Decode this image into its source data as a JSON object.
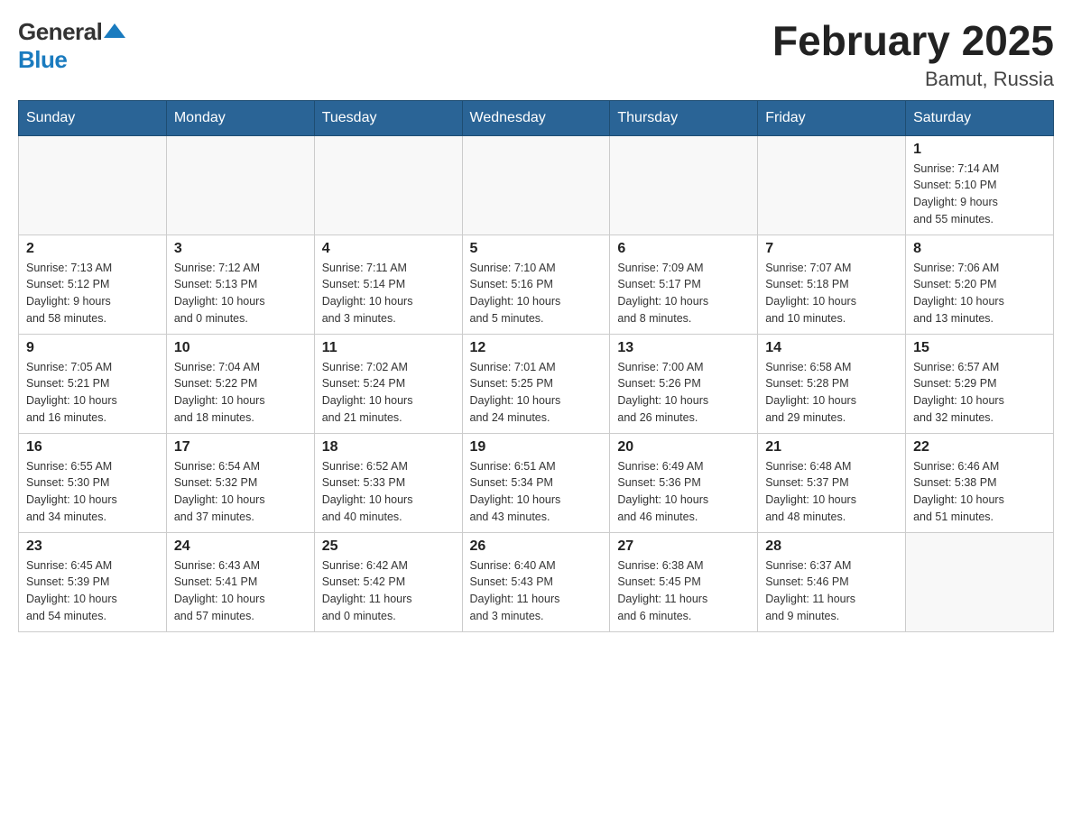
{
  "header": {
    "title": "February 2025",
    "location": "Bamut, Russia",
    "logo_general": "General",
    "logo_blue": "Blue"
  },
  "weekdays": [
    "Sunday",
    "Monday",
    "Tuesday",
    "Wednesday",
    "Thursday",
    "Friday",
    "Saturday"
  ],
  "weeks": [
    [
      {
        "day": "",
        "info": ""
      },
      {
        "day": "",
        "info": ""
      },
      {
        "day": "",
        "info": ""
      },
      {
        "day": "",
        "info": ""
      },
      {
        "day": "",
        "info": ""
      },
      {
        "day": "",
        "info": ""
      },
      {
        "day": "1",
        "info": "Sunrise: 7:14 AM\nSunset: 5:10 PM\nDaylight: 9 hours\nand 55 minutes."
      }
    ],
    [
      {
        "day": "2",
        "info": "Sunrise: 7:13 AM\nSunset: 5:12 PM\nDaylight: 9 hours\nand 58 minutes."
      },
      {
        "day": "3",
        "info": "Sunrise: 7:12 AM\nSunset: 5:13 PM\nDaylight: 10 hours\nand 0 minutes."
      },
      {
        "day": "4",
        "info": "Sunrise: 7:11 AM\nSunset: 5:14 PM\nDaylight: 10 hours\nand 3 minutes."
      },
      {
        "day": "5",
        "info": "Sunrise: 7:10 AM\nSunset: 5:16 PM\nDaylight: 10 hours\nand 5 minutes."
      },
      {
        "day": "6",
        "info": "Sunrise: 7:09 AM\nSunset: 5:17 PM\nDaylight: 10 hours\nand 8 minutes."
      },
      {
        "day": "7",
        "info": "Sunrise: 7:07 AM\nSunset: 5:18 PM\nDaylight: 10 hours\nand 10 minutes."
      },
      {
        "day": "8",
        "info": "Sunrise: 7:06 AM\nSunset: 5:20 PM\nDaylight: 10 hours\nand 13 minutes."
      }
    ],
    [
      {
        "day": "9",
        "info": "Sunrise: 7:05 AM\nSunset: 5:21 PM\nDaylight: 10 hours\nand 16 minutes."
      },
      {
        "day": "10",
        "info": "Sunrise: 7:04 AM\nSunset: 5:22 PM\nDaylight: 10 hours\nand 18 minutes."
      },
      {
        "day": "11",
        "info": "Sunrise: 7:02 AM\nSunset: 5:24 PM\nDaylight: 10 hours\nand 21 minutes."
      },
      {
        "day": "12",
        "info": "Sunrise: 7:01 AM\nSunset: 5:25 PM\nDaylight: 10 hours\nand 24 minutes."
      },
      {
        "day": "13",
        "info": "Sunrise: 7:00 AM\nSunset: 5:26 PM\nDaylight: 10 hours\nand 26 minutes."
      },
      {
        "day": "14",
        "info": "Sunrise: 6:58 AM\nSunset: 5:28 PM\nDaylight: 10 hours\nand 29 minutes."
      },
      {
        "day": "15",
        "info": "Sunrise: 6:57 AM\nSunset: 5:29 PM\nDaylight: 10 hours\nand 32 minutes."
      }
    ],
    [
      {
        "day": "16",
        "info": "Sunrise: 6:55 AM\nSunset: 5:30 PM\nDaylight: 10 hours\nand 34 minutes."
      },
      {
        "day": "17",
        "info": "Sunrise: 6:54 AM\nSunset: 5:32 PM\nDaylight: 10 hours\nand 37 minutes."
      },
      {
        "day": "18",
        "info": "Sunrise: 6:52 AM\nSunset: 5:33 PM\nDaylight: 10 hours\nand 40 minutes."
      },
      {
        "day": "19",
        "info": "Sunrise: 6:51 AM\nSunset: 5:34 PM\nDaylight: 10 hours\nand 43 minutes."
      },
      {
        "day": "20",
        "info": "Sunrise: 6:49 AM\nSunset: 5:36 PM\nDaylight: 10 hours\nand 46 minutes."
      },
      {
        "day": "21",
        "info": "Sunrise: 6:48 AM\nSunset: 5:37 PM\nDaylight: 10 hours\nand 48 minutes."
      },
      {
        "day": "22",
        "info": "Sunrise: 6:46 AM\nSunset: 5:38 PM\nDaylight: 10 hours\nand 51 minutes."
      }
    ],
    [
      {
        "day": "23",
        "info": "Sunrise: 6:45 AM\nSunset: 5:39 PM\nDaylight: 10 hours\nand 54 minutes."
      },
      {
        "day": "24",
        "info": "Sunrise: 6:43 AM\nSunset: 5:41 PM\nDaylight: 10 hours\nand 57 minutes."
      },
      {
        "day": "25",
        "info": "Sunrise: 6:42 AM\nSunset: 5:42 PM\nDaylight: 11 hours\nand 0 minutes."
      },
      {
        "day": "26",
        "info": "Sunrise: 6:40 AM\nSunset: 5:43 PM\nDaylight: 11 hours\nand 3 minutes."
      },
      {
        "day": "27",
        "info": "Sunrise: 6:38 AM\nSunset: 5:45 PM\nDaylight: 11 hours\nand 6 minutes."
      },
      {
        "day": "28",
        "info": "Sunrise: 6:37 AM\nSunset: 5:46 PM\nDaylight: 11 hours\nand 9 minutes."
      },
      {
        "day": "",
        "info": ""
      }
    ]
  ]
}
